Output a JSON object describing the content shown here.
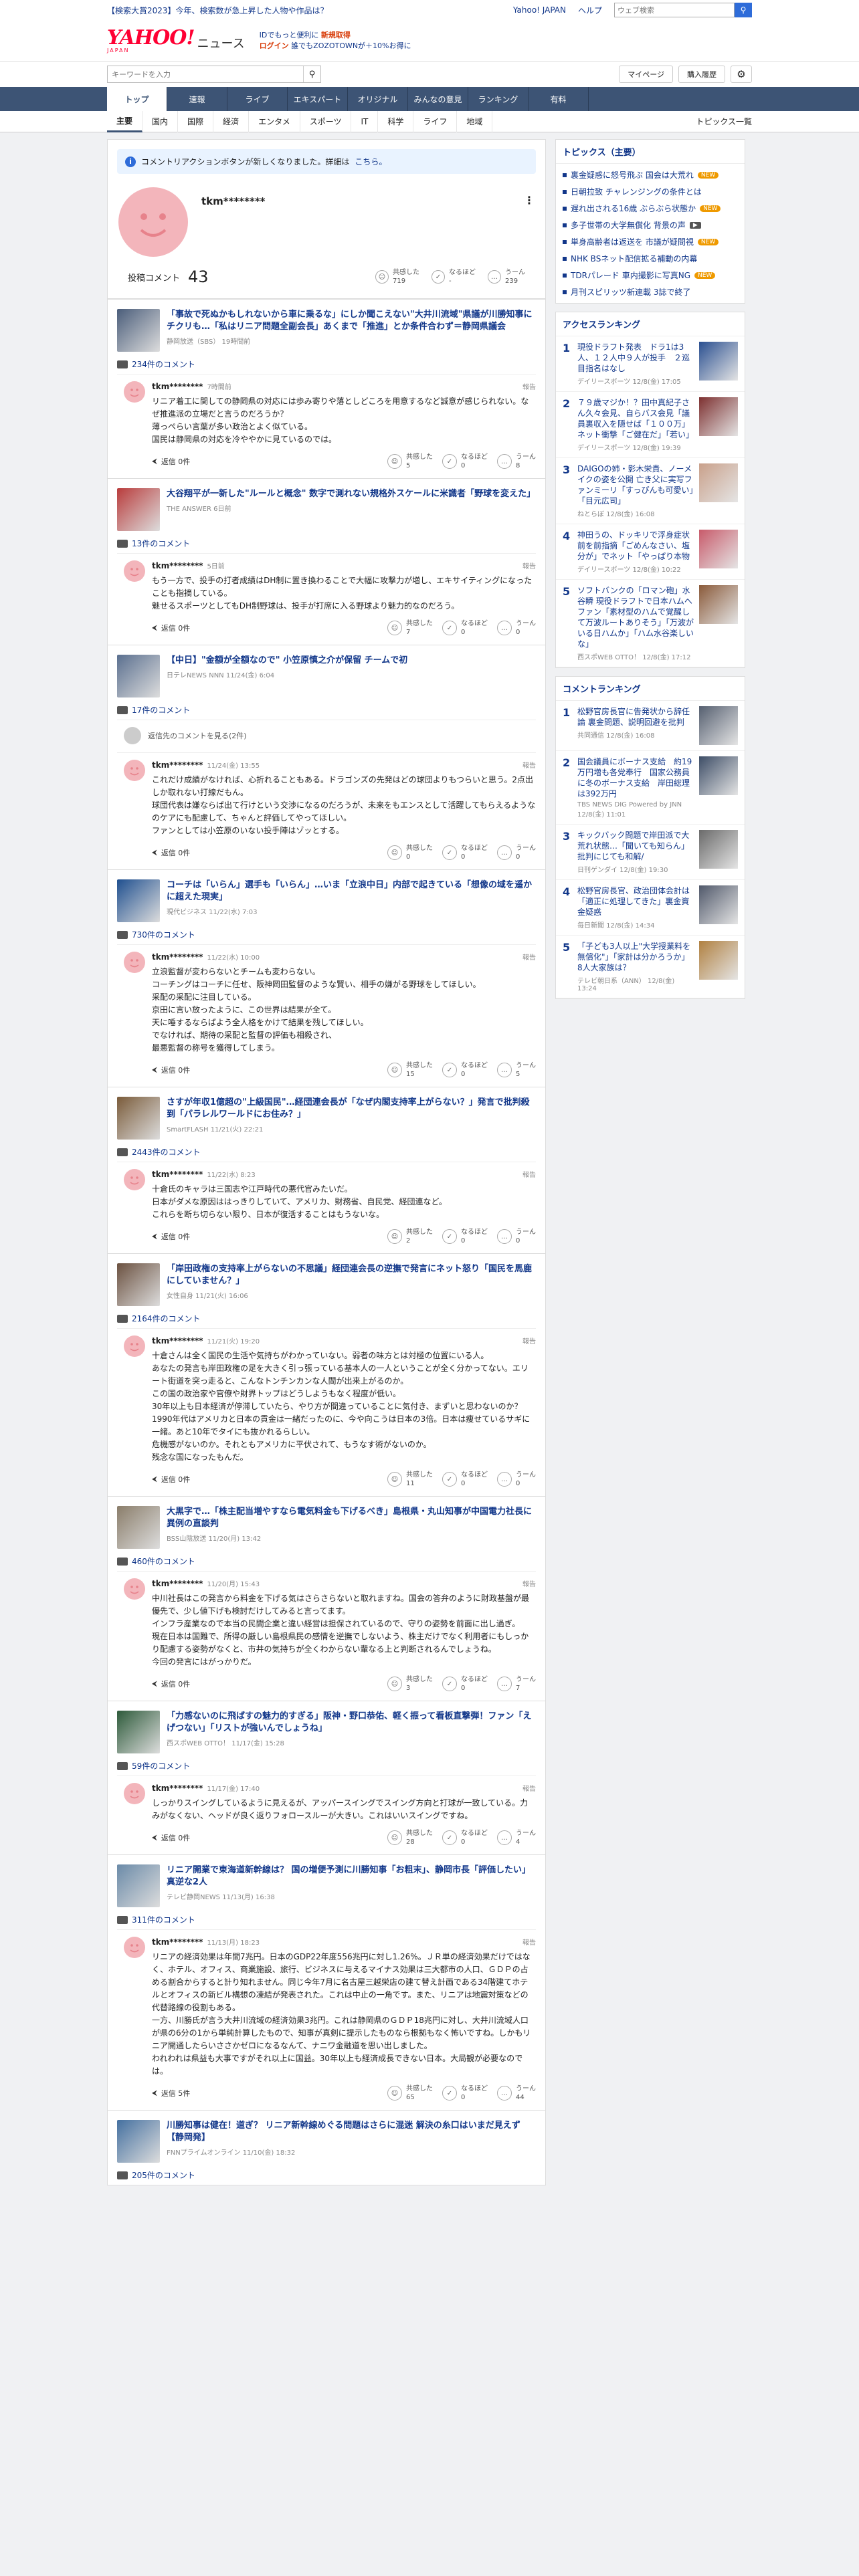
{
  "topbar": {
    "promo": "【検索大賞2023】今年、検索数が急上昇した人物や作品は？",
    "links": [
      "Yahoo! JAPAN",
      "ヘルプ"
    ],
    "search_placeholder": "ウェブ検索"
  },
  "header": {
    "logo_y": "YAHOO!",
    "logo_sub": "JAPAN",
    "logo_news": "ニュース",
    "promo_1": "IDでもっと便利に",
    "promo_1b": "新規取得",
    "promo_2": "ログイン",
    "promo_2b": "誰でもZOZOTOWNが＋10%お得に"
  },
  "subbar": {
    "search_placeholder": "キーワードを入力",
    "mypage": "マイページ",
    "purchase": "購入履歴"
  },
  "gnav": [
    "トップ",
    "速報",
    "ライブ",
    "エキスパート",
    "オリジナル",
    "みんなの意見",
    "ランキング",
    "有料"
  ],
  "catnav": {
    "items": [
      "主要",
      "国内",
      "国際",
      "経済",
      "エンタメ",
      "スポーツ",
      "IT",
      "科学",
      "ライフ",
      "地域"
    ],
    "last": "トピックス一覧"
  },
  "notice": {
    "text": "コメントリアクションボタンが新しくなりました。詳細は",
    "link": "こちら。"
  },
  "profile": {
    "username": "tkm********",
    "menu": "⋮",
    "stats_label": "投稿コメント",
    "stats_count": "43",
    "reactions": [
      {
        "label": "共感した",
        "value": "719"
      },
      {
        "label": "なるほど",
        "value": "-"
      },
      {
        "label": "うーん",
        "value": "239"
      }
    ]
  },
  "reaction_labels": {
    "a": "共感した",
    "b": "なるほど",
    "c": "うーん"
  },
  "reply_label": "返信",
  "report_label": "報告",
  "articles": [
    {
      "title": "「事故で死ぬかもしれないから車に乗るな」にしか聞こえない\"大井川流域\"県議が川勝知事にチクリも…「私はリニア問題全副会長」あくまで「推進」とか条件合わず＝静岡県議会",
      "src": "静岡放送（SBS） 19時間前",
      "count": "234件のコメント",
      "comments": [
        {
          "user": "tkm********",
          "time": "7時間前",
          "text": "リニア着工に関しての静岡県の対応には歩み寄りや落としどころを用意するなど誠意が感じられない。なぜ推進派の立場だと言うのだろうか？\n薄っぺらい言葉が多い政治とよく似ている。\n国民は静岡県の対応を冷ややかに見ているのでは。",
          "reply": "返信 0件",
          "r": [
            "5",
            "0",
            "8"
          ]
        }
      ]
    },
    {
      "title": "大谷翔平が一新した\"ルールと概念\" 数字で測れない規格外スケールに米識者「野球を変えた」",
      "src": "THE ANSWER 6日前",
      "count": "13件のコメント",
      "comments": [
        {
          "user": "tkm********",
          "time": "5日前",
          "text": "もう一方で、投手の打者成績はDH制に置き換わることで大幅に攻撃力が増し、エキサイティングになったことも指摘している。\n魅せるスポーツとしてもDH制野球は、投手が打席に入る野球より魅力的なのだろう。",
          "reply": "返信 0件",
          "r": [
            "7",
            "0",
            "0"
          ]
        }
      ]
    },
    {
      "title": "【中日】\"金額が全額なので\" 小笠原慎之介が保留 チームで初",
      "src": "日テレNEWS NNN 11/24(金) 6:04",
      "count": "17件のコメント",
      "hidden": "返信先のコメントを見る(2件)",
      "comments": [
        {
          "user": "tkm********",
          "time": "11/24(金) 13:55",
          "text": "これだけ成績がなければ、心折れることもある。ドラゴンズの先発はどの球団よりもつらいと思う。2点出しか取れない打線だもん。\n球団代表は嫌ならば出て行けという交渉になるのだろうが、未来をもエンスとして活躍してもらえるようなのケアにも配慮して、ちゃんと評価してやってほしい。\nファンとしては小笠原のいない投手陣はゾッとする。",
          "reply": "返信 0件",
          "r": [
            "0",
            "0",
            "0"
          ]
        }
      ]
    },
    {
      "title": "コーチは「いらん」選手も「いらん」…いま「立浪中日」内部で起きている「想像の域を遥かに超えた現実」",
      "src": "現代ビジネス 11/22(水) 7:03",
      "count": "730件のコメント",
      "comments": [
        {
          "user": "tkm********",
          "time": "11/22(水) 10:00",
          "text": "立浪監督が変わらないとチームも変わらない。\nコーチングはコーチに任せ、阪神岡田監督のような賢い、相手の嫌がる野球をしてほしい。\n采配の采配に注目している。\n京田に言い放ったように、この世界は結果が全て。\n天に唾するならばよう全人格をかけて結果を残してほしい。\nでなければ、期待の采配と監督の評価も相殺され、\n最悪監督の称号を獲得してしまう。",
          "reply": "返信 0件",
          "r": [
            "15",
            "0",
            "5"
          ]
        }
      ]
    },
    {
      "title": "さすが年収1億超の\"上級国民\"…経団連会長が「なぜ内閣支持率上がらない？」発言で批判殺到「パラレルワールドにお住み？」",
      "src": "SmartFLASH 11/21(火) 22:21",
      "count": "2443件のコメント",
      "comments": [
        {
          "user": "tkm********",
          "time": "11/22(水) 8:23",
          "text": "十倉氏のキャラは三国志や江戸時代の悪代官みたいだ。\n日本がダメな原因ははっきりしていて、アメリカ、財務省、自民党、経団連など。\nこれらを断ち切らない限り、日本が復活することはもうないな。",
          "reply": "返信 0件",
          "r": [
            "2",
            "0",
            "0"
          ]
        }
      ]
    },
    {
      "title": "「岸田政権の支持率上がらないの不思議」経団連会長の逆撫で発言にネット怒り「国民を馬鹿にしていません？」",
      "src": "女性自身 11/21(火) 16:06",
      "count": "2164件のコメント",
      "comments": [
        {
          "user": "tkm********",
          "time": "11/21(火) 19:20",
          "text": "十倉さんは全く国民の生活や気持ちがわかっていない。弱者の味方とは対極の位置にいる人。\nあなたの発言も岸田政権の足を大きく引っ張っている基本人の一人ということが全く分かってない。エリート街道を突っ走ると、こんなトンチンカンな人間が出来上がるのか。\nこの国の政治家や官僚や財界トップはどうしようもなく程度が低い。\n30年以上も日本経済が停滞していたら、やり方が間違っていることに気付き、まずいと思わないのか？\n1990年代はアメリカと日本の貢金は一緒だったのに、今や向こうは日本の3倍。日本は痩せているサギに一緒。あと10年でタイにも抜かれるらしい。\n危機感がないのか。それともアメリカに平伏されて、もうなす術がないのか。\n残念な国になったもんだ。",
          "reply": "返信 0件",
          "r": [
            "11",
            "0",
            "0"
          ]
        }
      ]
    },
    {
      "title": "大黒字で…「株主配当増やすなら電気料金も下げるべき」島根県・丸山知事が中国電力社長に異例の直談判",
      "src": "BSS山陰放送 11/20(月) 13:42",
      "count": "460件のコメント",
      "comments": [
        {
          "user": "tkm********",
          "time": "11/20(月) 15:43",
          "text": "中川社長はこの発言から料金を下げる気はさらさらないと取れますね。国会の答弁のように財政基盤が最優先で、少し値下げも検討だけしてみると言ってます。\nインフラ産業なので本当の民間企業と違い経営は担保されているので、守りの姿勢を前面に出し過ぎ。\n現在日本は国難で、所得の厳しい島根県民の感情を逆撫でしないよう、株主だけでなく利用者にもしっかり配慮する姿勢がなくと、市井の気持ちが全くわからない輩なる上と判断されるんでしょうね。\n今回の発言にはがっかりだ。",
          "reply": "返信 0件",
          "r": [
            "3",
            "0",
            "7"
          ]
        }
      ]
    },
    {
      "title": "「力感ないのに飛ばすの魅力的すぎる」阪神・野口恭佑、軽く振って看板直撃弾！ファン「えげつない」「リストが強いんでしょうね」",
      "src": "西スポWEB OTTO！ 11/17(金) 15:28",
      "count": "59件のコメント",
      "comments": [
        {
          "user": "tkm********",
          "time": "11/17(金) 17:40",
          "text": "しっかりスイングしているように見えるが、アッパースイングでスイング方向と打球が一致している。力みがなくない、ヘッドが良く返りフォロースルーが大きい。これはいいスイングですね。",
          "reply": "返信 0件",
          "r": [
            "28",
            "0",
            "4"
          ]
        }
      ]
    },
    {
      "title": "リニア開業で東海道新幹線は？ 国の増便予測に川勝知事「お粗末」、静岡市長「評価したい」真逆な2人",
      "src": "テレビ静岡NEWS 11/13(月) 16:38",
      "count": "311件のコメント",
      "comments": [
        {
          "user": "tkm********",
          "time": "11/13(月) 18:23",
          "text": "リニアの経済効果は年間7兆円。日本のGDP22年度556兆円に対し1.26%。ＪＲ単の経済効果だけではなく、ホテル、オフィス、商業施設、旅行、ビジネスに与えるマイナス効果は三大都市の人口、ＧＤＰの占める割合からすると計り知れません。同じ今年7月に名古屋三越栄店の建て替え計画である34階建てホテルとオフィスの新ビル構想の凍結が発表された。これは中止の一角です。また、リニアは地震対策などの代替路線の役割もある。\n一方、川勝氏が言う大井川流域の経済効果3兆円。これは静岡県のＧＤＰ18兆円に対し、大井川流域人口が県の6分の1から単純計算したもので、知事が真剣に提示したものなら根拠もなく怖いですね。しかもリニア開通したらいささかゼロになるなんて、ナニワ金融道を思い出しました。\nわれわれは県益も大事ですがそれ以上に国益。30年以上も経済成長できない日本。大局観が必要なのでは。",
          "reply": "返信 5件",
          "r": [
            "65",
            "0",
            "44"
          ]
        }
      ]
    },
    {
      "title": "川勝知事は健在！道ぎ？ リニア新幹線めぐる問題はさらに混迷 解決の糸口はいまだ見えず【静岡発】",
      "src": "FNNプライムオンライン 11/10(金) 18:32",
      "count": "205件のコメント",
      "comments": []
    }
  ],
  "side": {
    "topics_title": "トピックス（主要）",
    "topics": [
      {
        "t": "裏金疑惑に怒号飛ぶ 国会は大荒れ",
        "b": "new"
      },
      {
        "t": "日朝拉致 チャレンジングの条件とは",
        "b": ""
      },
      {
        "t": "遅れ出される16歳 ぶらぶら状態か",
        "b": "new"
      },
      {
        "t": "多子世帯の大学無償化 背景の声",
        "b": "v"
      },
      {
        "t": "単身高齢者は返送を 市議が疑問視",
        "b": "new"
      },
      {
        "t": "NHK BSネット配信拡る補動の内幕",
        "b": ""
      },
      {
        "t": "TDRパレード 車内撮影に写真NG",
        "b": "new"
      },
      {
        "t": "月刊スピリッツ新連載 3誌で終了",
        "b": ""
      }
    ],
    "access_title": "アクセスランキング",
    "access": [
      {
        "n": "1",
        "t": "現役ドラフト発表　ドラ1は3人、１２人中９人が投手　２巡目指名はなし",
        "s": "デイリースポーツ 12/8(金) 17:05"
      },
      {
        "n": "2",
        "t": "７９歳マジか！？田中真紀子さん久々会見、自らバス会見「議員裏収入を隠せば「１００万」ネット衝撃「ご健在だ」「若い」",
        "s": "デイリースポーツ 12/8(金) 19:39"
      },
      {
        "n": "3",
        "t": "DAIGOの姉・影木栄貴、ノーメイクの姿を公開 亡き父に実写ファンミーリ「すっぴんも可愛い」「目元広司」",
        "s": "ねとらぼ 12/8(金) 16:08"
      },
      {
        "n": "4",
        "t": "神田うの、ドッキリで浮身症状前を前指摘「ごめんなさい、塩分が」でネット「やっぱり本物",
        "s": "デイリースポーツ 12/8(金) 10:22"
      },
      {
        "n": "5",
        "t": "ソフトバンクの「ロマン砲」水谷瞬 現役ドラフトで日本ハムへ ファン「素材型のハムで覚醒して万波ルートありそう」「万波がいる日ハムか」「ハム水谷楽しいな」",
        "s": "西スポWEB OTTO！ 12/8(金) 17:12"
      }
    ],
    "comment_title": "コメントランキング",
    "comment_rank": [
      {
        "n": "1",
        "t": "松野官房長官に告発状から辞任論 裏金問題、説明回避を批判",
        "s": "共同通信 12/8(金) 16:08"
      },
      {
        "n": "2",
        "t": "国会議員にボーナス支給　約19万円増も各党奉行　国家公務員に冬のボーナス支給　岸田総理は392万円",
        "s": "TBS NEWS DIG Powered by JNN 12/8(金) 11:01"
      },
      {
        "n": "3",
        "t": "キックバック問題で岸田派で大荒れ状態…「聞いても知らん」批判にじても和解/",
        "s": "日刊ゲンダイ 12/8(金) 19:30"
      },
      {
        "n": "4",
        "t": "松野官房長官、政治団体会計は「適正に処理してきた」裏金資金疑惑",
        "s": "毎日新聞 12/8(金) 14:34"
      },
      {
        "n": "5",
        "t": "「子ども3人以上\"大学授業料を無償化\"」「家計は分かろうか」8人大家族は？",
        "s": "テレビ朝日系（ANN） 12/8(金) 13:24"
      }
    ]
  }
}
